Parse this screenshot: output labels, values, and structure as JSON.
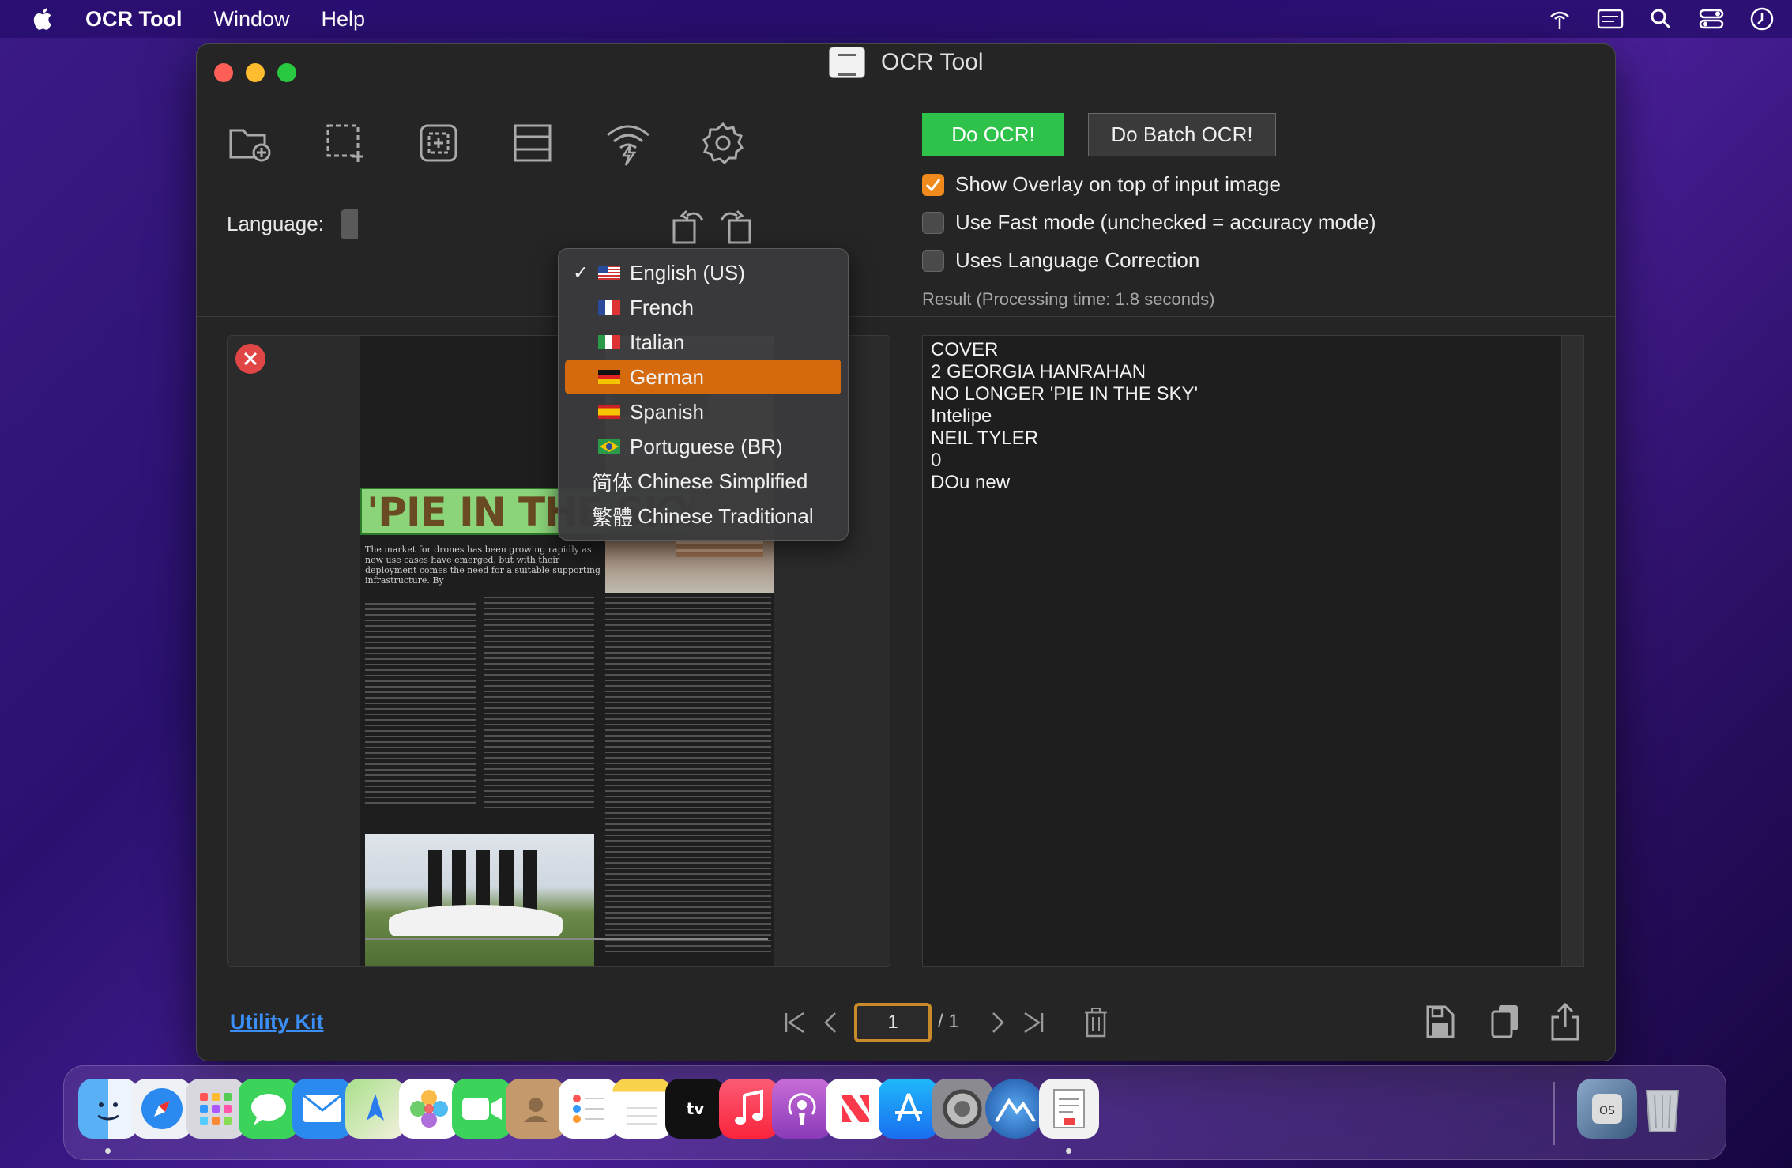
{
  "menubar": {
    "app_name": "OCR Tool",
    "items": [
      "Window",
      "Help"
    ]
  },
  "window": {
    "title": "OCR Tool"
  },
  "toolbar": {
    "icons": [
      "open-folder-icon",
      "select-region-icon",
      "capture-area-icon",
      "scan-icon",
      "wireless-icon",
      "gear-icon"
    ],
    "language_label": "Language:",
    "do_ocr_label": "Do OCR!",
    "do_batch_ocr_label": "Do Batch OCR!"
  },
  "options": {
    "show_overlay": {
      "label": "Show Overlay on top of input image",
      "checked": true
    },
    "fast_mode": {
      "label": "Use Fast mode (unchecked = accuracy mode)",
      "checked": false
    },
    "language_correction": {
      "label": "Uses Language Correction",
      "checked": false
    }
  },
  "result": {
    "label": "Result (Processing time: 1.8 seconds)",
    "lines": [
      "COVER",
      "2 GEORGIA HANRAHAN",
      "NO LONGER 'PIE IN THE SKY'",
      "Intelipe",
      "NEIL TYLER",
      "0",
      "DOu new"
    ]
  },
  "document_preview": {
    "headline": "'PIE IN THE SKY'",
    "lead": "The market for drones has been growing rapidly as new use cases have emerged, but with their deployment comes the need for a suitable supporting infrastructure.  By"
  },
  "language_menu": {
    "selected": "German",
    "checked": "English (US)",
    "items": [
      {
        "label": "English (US)",
        "prefix": "",
        "flag": "us"
      },
      {
        "label": "French",
        "prefix": "",
        "flag": "fr"
      },
      {
        "label": "Italian",
        "prefix": "",
        "flag": "it"
      },
      {
        "label": "German",
        "prefix": "",
        "flag": "de"
      },
      {
        "label": "Spanish",
        "prefix": "",
        "flag": "es"
      },
      {
        "label": "Portuguese (BR)",
        "prefix": "",
        "flag": "br"
      },
      {
        "label": "Chinese Simplified",
        "prefix": "简体",
        "flag": ""
      },
      {
        "label": "Chinese Traditional",
        "prefix": "繁體",
        "flag": ""
      }
    ]
  },
  "footer": {
    "utility_link": "Utility Kit",
    "page_current": "1",
    "page_total": "/ 1"
  },
  "colors": {
    "accent_orange": "#d4690e",
    "ocr_green": "#2ec24a",
    "link_blue": "#3a8ef6"
  },
  "dock": {
    "apps": [
      "finder-icon",
      "safari-icon",
      "launchpad-icon",
      "messages-icon",
      "mail-icon",
      "maps-icon",
      "photos-icon",
      "facetime-icon",
      "contacts-icon",
      "reminders-icon",
      "notes-icon",
      "apple-tv-icon",
      "music-icon",
      "podcasts-icon",
      "news-icon",
      "app-store-icon",
      "system-settings-icon",
      "altitude-icon",
      "ocr-tool-icon",
      "macos-installer-icon",
      "trash-icon"
    ]
  }
}
